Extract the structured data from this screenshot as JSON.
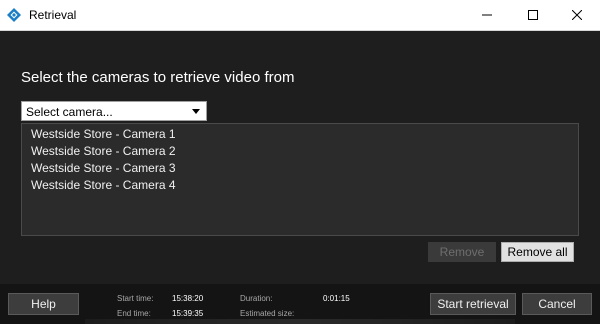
{
  "window": {
    "title": "Retrieval",
    "controls": {
      "minimize": "minimize-icon",
      "maximize": "maximize-icon",
      "close": "close-icon"
    }
  },
  "main": {
    "heading": "Select the cameras to retrieve video from",
    "camera_select": {
      "value": "Select camera..."
    },
    "cameras": [
      "Westside Store - Camera 1",
      "Westside Store - Camera 2",
      "Westside Store - Camera 3",
      "Westside Store - Camera 4"
    ],
    "remove_label": "Remove",
    "remove_all_label": "Remove all"
  },
  "footer": {
    "help_label": "Help",
    "start_time_label": "Start time:",
    "start_time_value": "15:38:20",
    "end_time_label": "End time:",
    "end_time_value": "15:39:35",
    "duration_label": "Duration:",
    "duration_value": "0:01:15",
    "estimated_size_label": "Estimated size:",
    "start_retrieval_label": "Start retrieval",
    "cancel_label": "Cancel"
  },
  "colors": {
    "background": "#1e1e1e",
    "footer": "#141414",
    "app_icon": "#1c7ec4"
  }
}
